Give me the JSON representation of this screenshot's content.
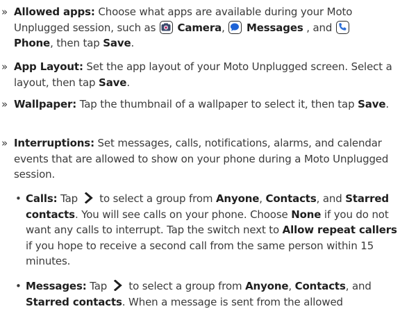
{
  "markers": {
    "section": "»",
    "bullet": "•"
  },
  "allowed_apps": {
    "title": "Allowed apps:",
    "text1": " Choose what apps are available during your Moto Unplugged session, such as ",
    "camera": "Camera",
    "sep1": ", ",
    "messages": "Messages",
    "sep2": " , and ",
    "phone": "Phone",
    "text2": ", then tap ",
    "save": "Save",
    "end": "."
  },
  "app_layout": {
    "title": "App Layout:",
    "text1": " Set the app layout of your Moto Unplugged screen. Select a layout, then tap ",
    "save": "Save",
    "end": "."
  },
  "wallpaper": {
    "title": "Wallpaper:",
    "text1": " Tap the thumbnail of a wallpaper to select it, then tap ",
    "save": "Save",
    "end": "."
  },
  "interruptions": {
    "title": "Interruptions:",
    "text1": " Set messages, calls, notifications, alarms, and calendar events that are allowed to show on your phone during a Moto Unplugged session."
  },
  "calls": {
    "title": "Calls:",
    "tap": " Tap ",
    "text1": " to select a group from ",
    "anyone": "Anyone",
    "sep1": ", ",
    "contacts": "Contacts",
    "sep2": ", and ",
    "starred": "Starred contacts",
    "text2": ". You will see calls on your phone. Choose ",
    "none": "None",
    "text3": " if you do not want any calls to interrupt. Tap the switch next to ",
    "allow_repeat": "Allow repeat callers",
    "text4": " if you hope to receive a second call from the same person within 15 minutes."
  },
  "messages_item": {
    "title": "Messages:",
    "tap": " Tap ",
    "text1": " to select a group from ",
    "anyone": "Anyone",
    "sep1": ", ",
    "contacts": "Contacts",
    "sep2": ", and ",
    "starred": "Starred contacts",
    "text2": ". When a message is sent from the allowed"
  },
  "icons": {
    "camera": "camera-app-icon",
    "messages": "messages-app-icon",
    "phone": "phone-app-icon",
    "chevron": "chevron-right-icon"
  }
}
